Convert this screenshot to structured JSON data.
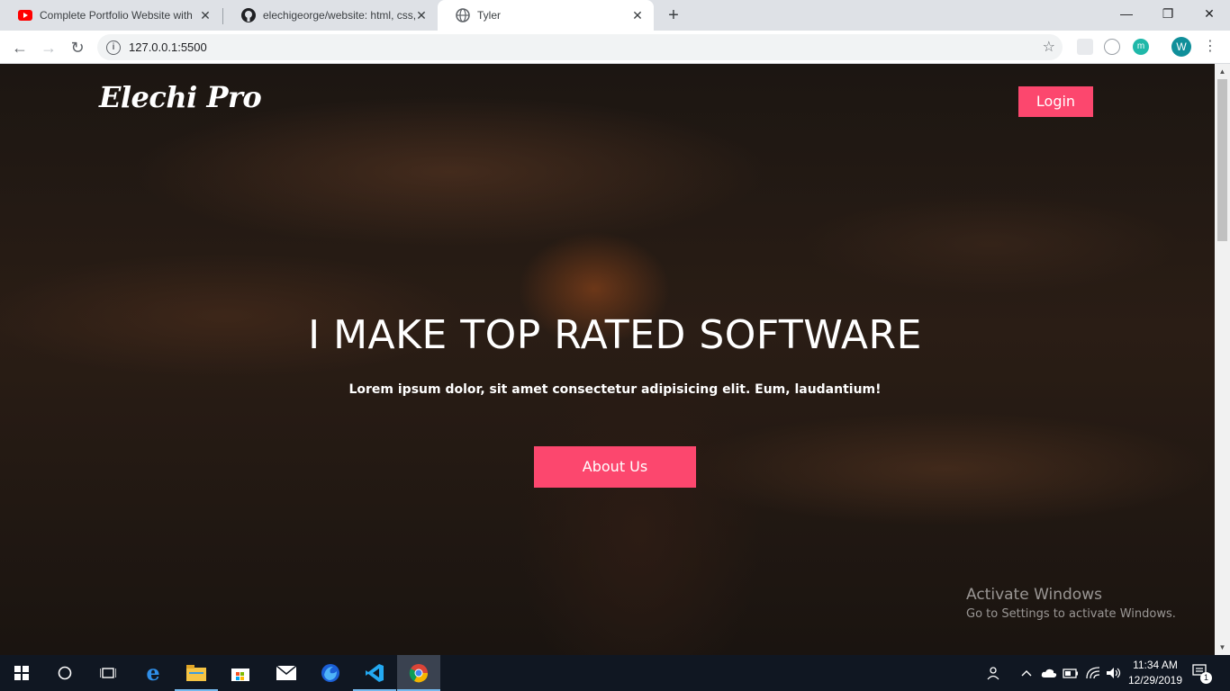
{
  "browser": {
    "tabs": [
      {
        "title": "Complete Portfolio Website with",
        "icon": "youtube-icon",
        "active": false
      },
      {
        "title": "elechigeorge/website: html, css, j",
        "icon": "github-icon",
        "active": false
      },
      {
        "title": "Tyler",
        "icon": "globe-icon",
        "active": true
      }
    ],
    "close_glyph": "✕",
    "new_tab_glyph": "+",
    "window_controls": {
      "minimize": "—",
      "maximize": "❐",
      "close": "✕"
    },
    "url": "127.0.0.1:5500",
    "profile_initial": "W",
    "extension_m": "m"
  },
  "page": {
    "logo": "Elechi Pro",
    "login_label": "Login",
    "hero_title": "I MAKE TOP RATED SOFTWARE",
    "hero_subtitle": "Lorem ipsum dolor, sit amet consectetur adipisicing elit. Eum, laudantium!",
    "about_label": "About Us",
    "accent_color": "#fc476e"
  },
  "watermark": {
    "line1": "Activate Windows",
    "line2": "Go to Settings to activate Windows."
  },
  "taskbar": {
    "time": "11:34 AM",
    "date": "12/29/2019",
    "notification_count": "1"
  }
}
